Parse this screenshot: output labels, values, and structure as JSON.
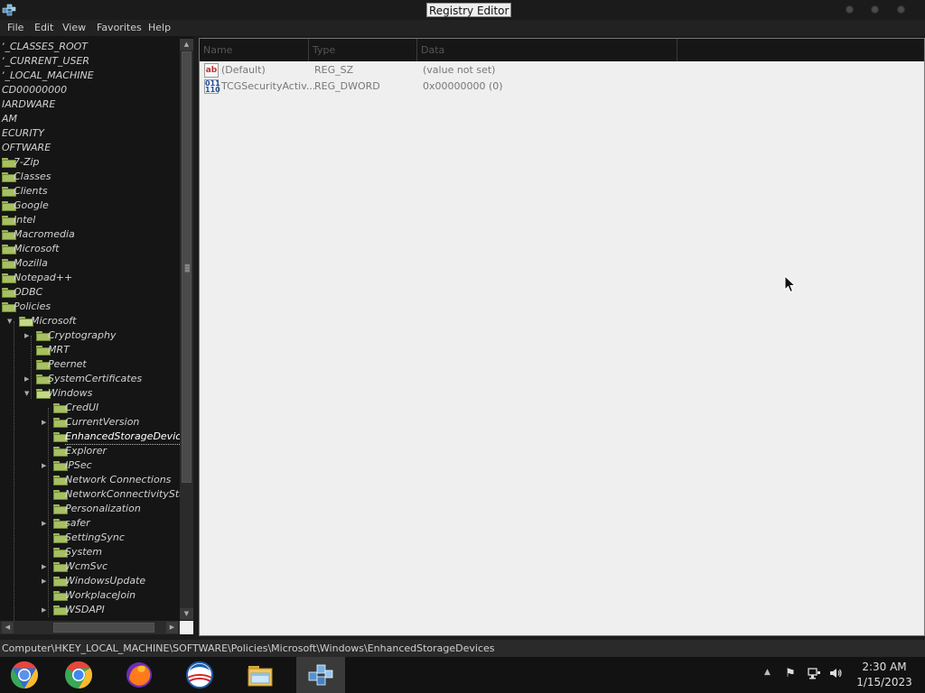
{
  "window": {
    "title": "Registry Editor"
  },
  "menu": [
    "File",
    "Edit",
    "View",
    "Favorites",
    "Help"
  ],
  "tree": {
    "items": [
      {
        "label": "ʼ_CLASSES_ROOT",
        "level": 0,
        "expander": "",
        "folder": false
      },
      {
        "label": "ʼ_CURRENT_USER",
        "level": 0,
        "expander": "",
        "folder": false
      },
      {
        "label": "ʼ_LOCAL_MACHINE",
        "level": 0,
        "expander": "",
        "folder": false
      },
      {
        "label": "CD00000000",
        "level": 0,
        "expander": "",
        "folder": false
      },
      {
        "label": "IARDWARE",
        "level": 0,
        "expander": "",
        "folder": false
      },
      {
        "label": "AM",
        "level": 0,
        "expander": "",
        "folder": false
      },
      {
        "label": "ECURITY",
        "level": 0,
        "expander": "",
        "folder": false
      },
      {
        "label": "OFTWARE",
        "level": 0,
        "expander": "",
        "folder": false
      },
      {
        "label": "7-Zip",
        "level": 1,
        "expander": "",
        "folder": true
      },
      {
        "label": "Classes",
        "level": 1,
        "expander": "",
        "folder": true
      },
      {
        "label": "Clients",
        "level": 1,
        "expander": "",
        "folder": true
      },
      {
        "label": "Google",
        "level": 1,
        "expander": "",
        "folder": true
      },
      {
        "label": "Intel",
        "level": 1,
        "expander": "",
        "folder": true
      },
      {
        "label": "Macromedia",
        "level": 1,
        "expander": "",
        "folder": true
      },
      {
        "label": "Microsoft",
        "level": 1,
        "expander": "",
        "folder": true
      },
      {
        "label": "Mozilla",
        "level": 1,
        "expander": "",
        "folder": true
      },
      {
        "label": "Notepad++",
        "level": 1,
        "expander": "",
        "folder": true
      },
      {
        "label": "ODBC",
        "level": 1,
        "expander": "",
        "folder": true
      },
      {
        "label": "Policies",
        "level": 1,
        "expander": "",
        "folder": true
      },
      {
        "label": "Microsoft",
        "level": 2,
        "expander": "open",
        "folder": true,
        "open": true
      },
      {
        "label": "Cryptography",
        "level": 3,
        "expander": "closed",
        "folder": true
      },
      {
        "label": "MRT",
        "level": 3,
        "expander": "",
        "folder": true
      },
      {
        "label": "Peernet",
        "level": 3,
        "expander": "",
        "folder": true
      },
      {
        "label": "SystemCertificates",
        "level": 3,
        "expander": "closed",
        "folder": true
      },
      {
        "label": "Windows",
        "level": 3,
        "expander": "open",
        "folder": true,
        "open": true
      },
      {
        "label": "CredUI",
        "level": 4,
        "expander": "",
        "folder": true
      },
      {
        "label": "CurrentVersion",
        "level": 4,
        "expander": "closed",
        "folder": true
      },
      {
        "label": "EnhancedStorageDevices",
        "level": 4,
        "expander": "",
        "folder": true,
        "selected": true
      },
      {
        "label": "Explorer",
        "level": 4,
        "expander": "",
        "folder": true
      },
      {
        "label": "IPSec",
        "level": 4,
        "expander": "closed",
        "folder": true
      },
      {
        "label": "Network Connections",
        "level": 4,
        "expander": "",
        "folder": true
      },
      {
        "label": "NetworkConnectivityStatu",
        "level": 4,
        "expander": "",
        "folder": true
      },
      {
        "label": "Personalization",
        "level": 4,
        "expander": "",
        "folder": true
      },
      {
        "label": "safer",
        "level": 4,
        "expander": "closed",
        "folder": true
      },
      {
        "label": "SettingSync",
        "level": 4,
        "expander": "",
        "folder": true
      },
      {
        "label": "System",
        "level": 4,
        "expander": "",
        "folder": true
      },
      {
        "label": "WcmSvc",
        "level": 4,
        "expander": "closed",
        "folder": true
      },
      {
        "label": "WindowsUpdate",
        "level": 4,
        "expander": "closed",
        "folder": true
      },
      {
        "label": "WorkplaceJoin",
        "level": 4,
        "expander": "",
        "folder": true
      },
      {
        "label": "WSDAPI",
        "level": 4,
        "expander": "closed",
        "folder": true
      }
    ]
  },
  "values": {
    "columns": [
      "Name",
      "Type",
      "Data"
    ],
    "rows": [
      {
        "icon": "string-value-icon",
        "icon_text": "ab",
        "name": "(Default)",
        "type": "REG_SZ",
        "data": "(value not set)"
      },
      {
        "icon": "dword-value-icon",
        "icon_text": "011 110",
        "name": "TCGSecurityActiv...",
        "type": "REG_DWORD",
        "data": "0x00000000 (0)"
      }
    ]
  },
  "status": {
    "path": "Computer\\HKEY_LOCAL_MACHINE\\SOFTWARE\\Policies\\Microsoft\\Windows\\EnhancedStorageDevices"
  },
  "taskbar": {
    "apps": [
      {
        "name": "chromium-icon",
        "active": false
      },
      {
        "name": "chrome-icon",
        "active": false
      },
      {
        "name": "firefox-icon",
        "active": false
      },
      {
        "name": "obama-logo-icon",
        "active": false
      },
      {
        "name": "file-explorer-icon",
        "active": false
      },
      {
        "name": "registry-editor-icon",
        "active": true
      }
    ],
    "tray": [
      "show-hidden-icons-chevron",
      "action-center-flag-icon",
      "network-icon",
      "volume-icon"
    ],
    "clock": {
      "time": "2:30 AM",
      "date": "1/15/2023"
    }
  },
  "colors": {
    "folder": "#a7c062",
    "values_bg": "#efefef",
    "tree_bg": "#151515"
  }
}
